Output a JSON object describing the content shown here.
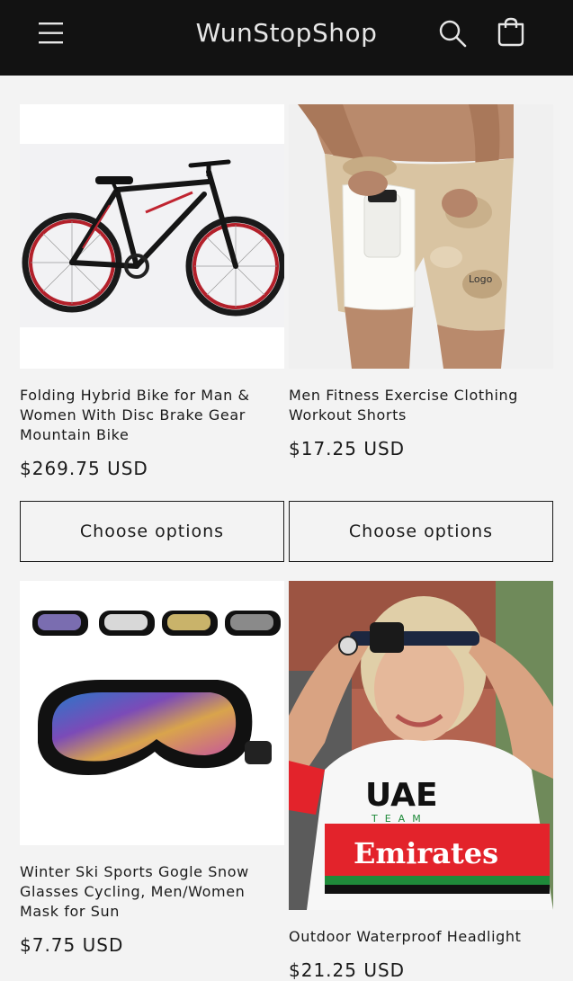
{
  "header": {
    "brand": "WunStopShop",
    "icons": [
      "menu-icon",
      "search-icon",
      "cart-icon"
    ],
    "background": "#121212"
  },
  "products": [
    {
      "title": "Folding Hybrid Bike for Man & Women With Disc Brake Gear Mountain Bike",
      "price": "$269.75 USD",
      "button": "Choose options",
      "image": "mountain-bike-image"
    },
    {
      "title": "Men Fitness Exercise Clothing Workout Shorts",
      "price": "$17.25 USD",
      "button": "Choose options",
      "image": "workout-shorts-image",
      "image_text": "Logo"
    },
    {
      "title": "Winter Ski Sports Gogle Snow Glasses Cycling, Men/Women Mask for Sun",
      "price": "$7.75 USD",
      "image": "ski-goggles-image"
    },
    {
      "title": "Outdoor Waterproof Headlight",
      "price": "$21.25 USD",
      "image": "headlamp-image",
      "image_text": [
        "UAE",
        "TEAM",
        "Emirates"
      ]
    }
  ]
}
